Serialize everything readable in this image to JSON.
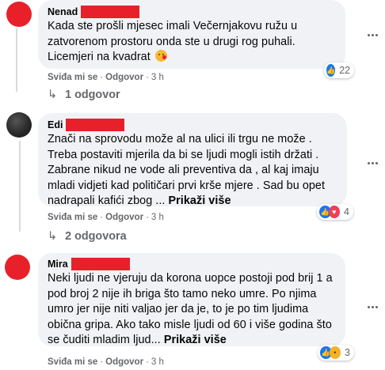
{
  "comments": [
    {
      "author": "Nenad",
      "text": "Kada ste prošli mjesec imali Večernjakovu ružu u zatvorenom prostoru onda ste u drugi rog puhali. Licemjeri na kvadrat",
      "emoji": "kiss-face-emoji",
      "like_label": "Sviđa mi se",
      "reply_label": "Odgovor",
      "time": "3 h",
      "reaction_count": "22",
      "reactions": [
        "like-icon"
      ],
      "replies_label": "1 odgovor"
    },
    {
      "author": "Edi",
      "text": "Znači na sprovodu može al na ulici ili trgu ne može . Treba postaviti mjerila da bi se ljudi mogli istih držati . Zabrane nikud ne vode ali preventiva da , al kaj imaju mladi vidjeti kad političari prvi krše mjere . Sad bu opet nadrapali kafići zbog ... ",
      "see_more": "Prikaži više",
      "like_label": "Sviđa mi se",
      "reply_label": "Odgovor",
      "time": "3 h",
      "reaction_count": "4",
      "reactions": [
        "like-icon",
        "love-icon"
      ],
      "replies_label": "2 odgovora"
    },
    {
      "author": "Mira",
      "text": "Neki ljudi ne vjeruju da korona uopce postoji pod brij 1 a pod broj 2 nije ih briga što tamo neko umre. Po njima umro jer nije niti valjao jer da je, to je po tim ljudima obična gripa. Ako tako misle ljudi od 60 i više godina što se čuditi mladim ljud... ",
      "see_more": "Prikaži više",
      "like_label": "Sviđa mi se",
      "reply_label": "Odgovor",
      "time": "3 h",
      "reaction_count": "3",
      "reactions": [
        "like-icon",
        "haha-icon"
      ]
    }
  ],
  "colors": {
    "bubble": "#f0f2f5",
    "redaction": "#e8202a",
    "meta": "#65676b",
    "like": "#1877f2"
  }
}
